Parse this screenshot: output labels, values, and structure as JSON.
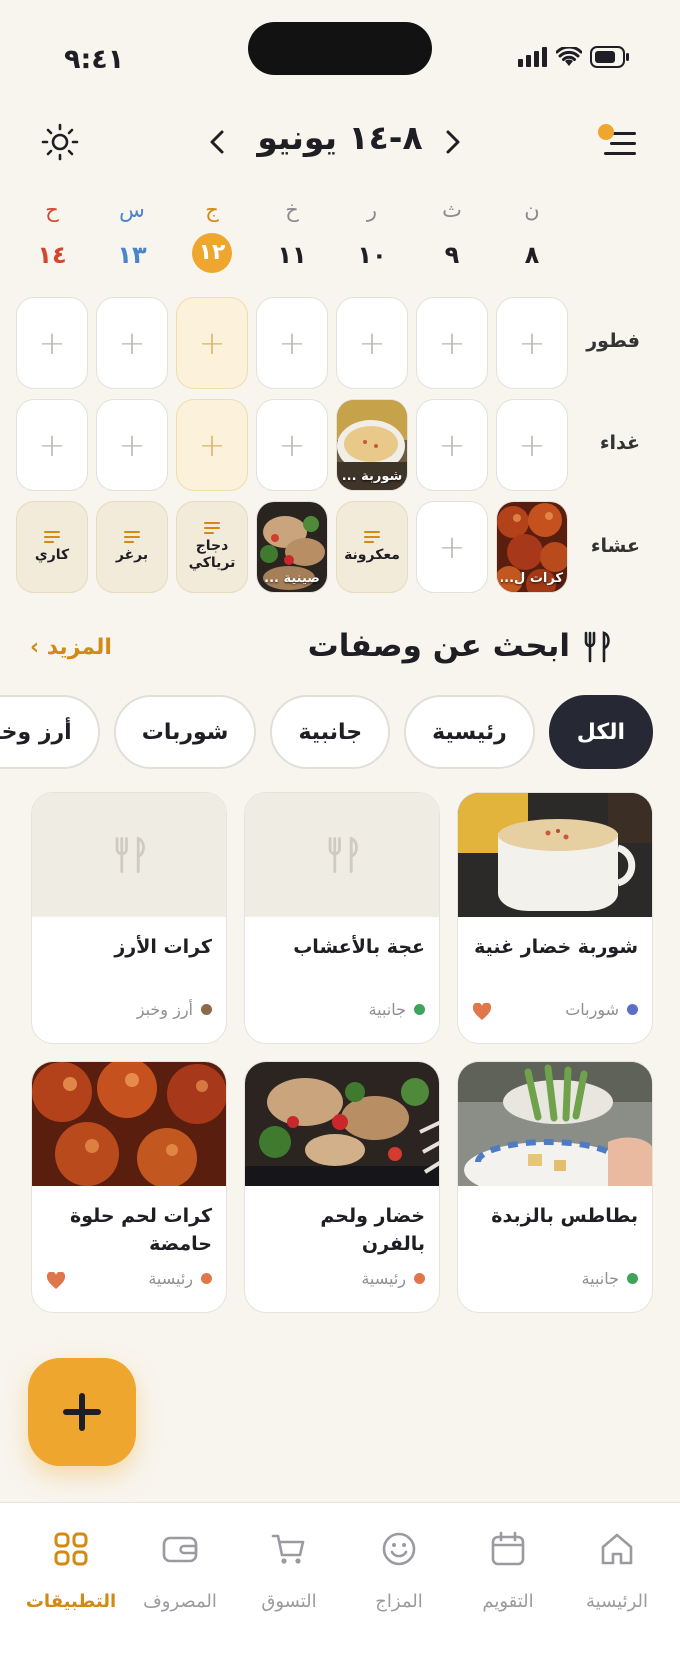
{
  "status": {
    "time": "٩:٤١"
  },
  "header": {
    "week_title": "٨-١٤ يونيو"
  },
  "days": [
    {
      "letter": "ن",
      "num": "٨",
      "letter_color": "#8A8A90",
      "num_color": "#1E1E24",
      "today": false
    },
    {
      "letter": "ث",
      "num": "٩",
      "letter_color": "#8A8A90",
      "num_color": "#1E1E24",
      "today": false
    },
    {
      "letter": "ر",
      "num": "١٠",
      "letter_color": "#8A8A90",
      "num_color": "#1E1E24",
      "today": false
    },
    {
      "letter": "خ",
      "num": "١١",
      "letter_color": "#8A8A90",
      "num_color": "#1E1E24",
      "today": false
    },
    {
      "letter": "ج",
      "num": "١٢",
      "letter_color": "#D28A14",
      "num_color": "#FFFFFF",
      "today": true
    },
    {
      "letter": "س",
      "num": "١٣",
      "letter_color": "#4A84C9",
      "num_color": "#4A84C9",
      "today": false
    },
    {
      "letter": "ح",
      "num": "١٤",
      "letter_color": "#D2472F",
      "num_color": "#D2472F",
      "today": false
    }
  ],
  "meals": {
    "rows": [
      {
        "label": "فطور"
      },
      {
        "label": "غداء"
      },
      {
        "label": "عشاء"
      }
    ],
    "lunch_photo_label": "شوربة ...",
    "dinner": {
      "d0": "كرات ل...",
      "d2": "معكرونة",
      "d3": "صينية ...",
      "d4": "دجاج ترياكي",
      "d5": "برغر",
      "d6": "كاري"
    }
  },
  "recipes": {
    "title": "ابحث عن وصفات",
    "more": "المزيد ›",
    "chips": [
      "الكل",
      "رئيسية",
      "جانبية",
      "شوربات",
      "أرز وخبز"
    ],
    "cards": [
      {
        "title": "شوربة خضار غنية",
        "category": "شوربات",
        "dot": "#5B6FC7",
        "fav": true
      },
      {
        "title": "عجة بالأعشاب",
        "category": "جانبية",
        "dot": "#3FA35B",
        "fav": false
      },
      {
        "title": "كرات الأرز",
        "category": "أرز وخبز",
        "dot": "#8C6A4A",
        "fav": false
      },
      {
        "title": "بطاطس بالزبدة",
        "category": "جانبية",
        "dot": "#3FA35B",
        "fav": false
      },
      {
        "title": "خضار ولحم بالفرن",
        "category": "رئيسية",
        "dot": "#E0774B",
        "fav": false
      },
      {
        "title": "كرات لحم حلوة حامضة",
        "category": "رئيسية",
        "dot": "#E0774B",
        "fav": true
      }
    ]
  },
  "tabbar": {
    "items": [
      "الرئيسية",
      "التقويم",
      "المزاج",
      "التسوق",
      "المصروف",
      "التطبيقات"
    ],
    "active_color": "#D28A14",
    "inactive_color": "#9A9AA0"
  }
}
